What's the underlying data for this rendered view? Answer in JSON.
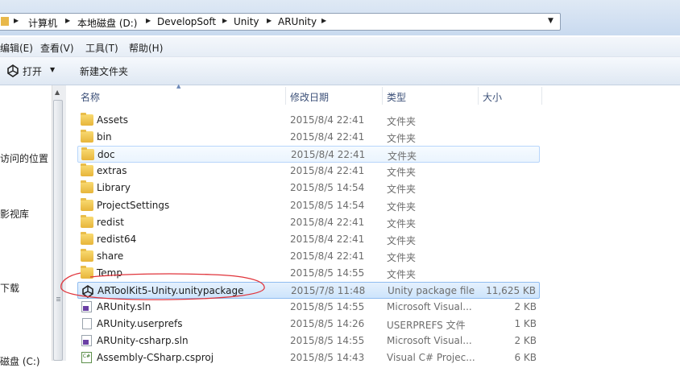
{
  "address": {
    "crumbs": [
      "计算机",
      "本地磁盘 (D:)",
      "DevelopSoft",
      "Unity",
      "ARUnity"
    ]
  },
  "menu": [
    "编辑(E)",
    "查看(V)",
    "工具(T)",
    "帮助(H)"
  ],
  "toolbar": {
    "open_label": "打开",
    "new_folder_label": "新建文件夹"
  },
  "nav": [
    "访问的位置",
    "影视库",
    "下载",
    "磁盘 (C:)"
  ],
  "columns": {
    "name": "名称",
    "date": "修改日期",
    "type": "类型",
    "size": "大小"
  },
  "files": [
    {
      "name": "Assets",
      "date": "2015/8/4 22:41",
      "type": "文件夹",
      "size": "",
      "icon": "folder-icon"
    },
    {
      "name": "bin",
      "date": "2015/8/4 22:41",
      "type": "文件夹",
      "size": "",
      "icon": "folder-icon"
    },
    {
      "name": "doc",
      "date": "2015/8/4 22:41",
      "type": "文件夹",
      "size": "",
      "icon": "folder-icon"
    },
    {
      "name": "extras",
      "date": "2015/8/4 22:41",
      "type": "文件夹",
      "size": "",
      "icon": "folder-icon"
    },
    {
      "name": "Library",
      "date": "2015/8/5 14:54",
      "type": "文件夹",
      "size": "",
      "icon": "folder-icon"
    },
    {
      "name": "ProjectSettings",
      "date": "2015/8/5 14:54",
      "type": "文件夹",
      "size": "",
      "icon": "folder-icon"
    },
    {
      "name": "redist",
      "date": "2015/8/4 22:41",
      "type": "文件夹",
      "size": "",
      "icon": "folder-icon"
    },
    {
      "name": "redist64",
      "date": "2015/8/4 22:41",
      "type": "文件夹",
      "size": "",
      "icon": "folder-icon"
    },
    {
      "name": "share",
      "date": "2015/8/4 22:41",
      "type": "文件夹",
      "size": "",
      "icon": "folder-icon"
    },
    {
      "name": "Temp",
      "date": "2015/8/5 14:55",
      "type": "文件夹",
      "size": "",
      "icon": "folder-icon"
    },
    {
      "name": "ARToolKit5-Unity.unitypackage",
      "date": "2015/7/8 11:48",
      "type": "Unity package file",
      "size": "11,625 KB",
      "icon": "unity-icon"
    },
    {
      "name": "ARUnity.sln",
      "date": "2015/8/5 14:55",
      "type": "Microsoft Visual...",
      "size": "2 KB",
      "icon": "visual-studio-icon"
    },
    {
      "name": "ARUnity.userprefs",
      "date": "2015/8/5 14:26",
      "type": "USERPREFS 文件",
      "size": "1 KB",
      "icon": "document-icon"
    },
    {
      "name": "ARUnity-csharp.sln",
      "date": "2015/8/5 14:55",
      "type": "Microsoft Visual...",
      "size": "2 KB",
      "icon": "visual-studio-icon"
    },
    {
      "name": "Assembly-CSharp.csproj",
      "date": "2015/8/5 14:43",
      "type": "Visual C# Projec...",
      "size": "6 KB",
      "icon": "csharp-project-icon"
    }
  ],
  "colors": {
    "annotation": "#e0343b",
    "selection": "#cde4fc",
    "accent": "#3c5078"
  }
}
